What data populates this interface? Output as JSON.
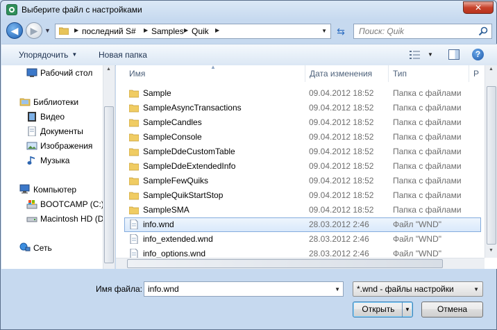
{
  "window": {
    "title": "Выберите файл с настройками",
    "close_symbol": "✕"
  },
  "address": {
    "crumbs": [
      "последний S#",
      "Samples",
      "Quik"
    ],
    "search_placeholder": "Поиск: Quik"
  },
  "toolbar": {
    "organize_label": "Упорядочить",
    "new_folder_label": "Новая папка"
  },
  "nav_tree": {
    "desktop": "Рабочий стол",
    "libraries": "Библиотеки",
    "video": "Видео",
    "documents": "Документы",
    "pictures": "Изображения",
    "music": "Музыка",
    "computer": "Компьютер",
    "bootcamp": "BOOTCAMP (C:)",
    "macintosh": "Macintosh HD (D",
    "network": "Сеть"
  },
  "columns": {
    "name": "Имя",
    "date": "Дата изменения",
    "type": "Тип",
    "size": "Р"
  },
  "files": [
    {
      "name": "Sample",
      "date": "09.04.2012 18:52",
      "type": "Папка с файлами",
      "icon": "folder"
    },
    {
      "name": "SampleAsyncTransactions",
      "date": "09.04.2012 18:52",
      "type": "Папка с файлами",
      "icon": "folder"
    },
    {
      "name": "SampleCandles",
      "date": "09.04.2012 18:52",
      "type": "Папка с файлами",
      "icon": "folder"
    },
    {
      "name": "SampleConsole",
      "date": "09.04.2012 18:52",
      "type": "Папка с файлами",
      "icon": "folder"
    },
    {
      "name": "SampleDdeCustomTable",
      "date": "09.04.2012 18:52",
      "type": "Папка с файлами",
      "icon": "folder"
    },
    {
      "name": "SampleDdeExtendedInfo",
      "date": "09.04.2012 18:52",
      "type": "Папка с файлами",
      "icon": "folder"
    },
    {
      "name": "SampleFewQuiks",
      "date": "09.04.2012 18:52",
      "type": "Папка с файлами",
      "icon": "folder"
    },
    {
      "name": "SampleQuikStartStop",
      "date": "09.04.2012 18:52",
      "type": "Папка с файлами",
      "icon": "folder"
    },
    {
      "name": "SampleSMA",
      "date": "09.04.2012 18:52",
      "type": "Папка с файлами",
      "icon": "folder"
    },
    {
      "name": "info.wnd",
      "date": "28.03.2012 2:46",
      "type": "Файл \"WND\"",
      "icon": "file",
      "selected": true
    },
    {
      "name": "info_extended.wnd",
      "date": "28.03.2012 2:46",
      "type": "Файл \"WND\"",
      "icon": "file"
    },
    {
      "name": "info_options.wnd",
      "date": "28.03.2012 2:46",
      "type": "Файл \"WND\"",
      "icon": "file"
    }
  ],
  "footer": {
    "filename_label": "Имя файла:",
    "filename_value": "info.wnd",
    "filter_value": "*.wnd - файлы настройки",
    "open_label": "Открыть",
    "cancel_label": "Отмена"
  }
}
